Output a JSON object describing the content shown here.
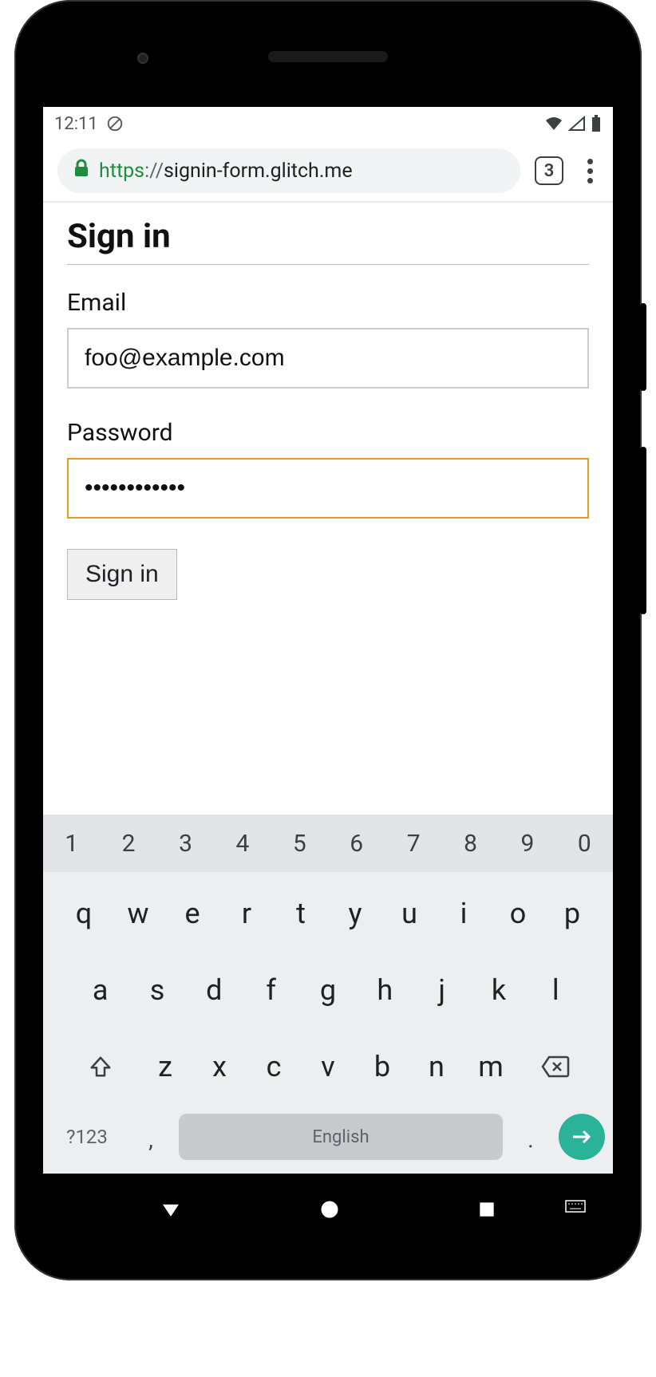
{
  "status_bar": {
    "time": "12:11"
  },
  "browser": {
    "url_scheme": "https",
    "url_sep": "://",
    "url_host": "signin-form.glitch.me",
    "tab_count": "3"
  },
  "page": {
    "title": "Sign in",
    "email_label": "Email",
    "email_value": "foo@example.com",
    "password_label": "Password",
    "password_value": "••••••••••••",
    "submit_label": "Sign in"
  },
  "keyboard": {
    "numbers": [
      "1",
      "2",
      "3",
      "4",
      "5",
      "6",
      "7",
      "8",
      "9",
      "0"
    ],
    "row1": [
      "q",
      "w",
      "e",
      "r",
      "t",
      "y",
      "u",
      "i",
      "o",
      "p"
    ],
    "row2": [
      "a",
      "s",
      "d",
      "f",
      "g",
      "h",
      "j",
      "k",
      "l"
    ],
    "row3": [
      "z",
      "x",
      "c",
      "v",
      "b",
      "n",
      "m"
    ],
    "symbols_label": "?123",
    "comma": ",",
    "period": ".",
    "space_label": "English"
  }
}
